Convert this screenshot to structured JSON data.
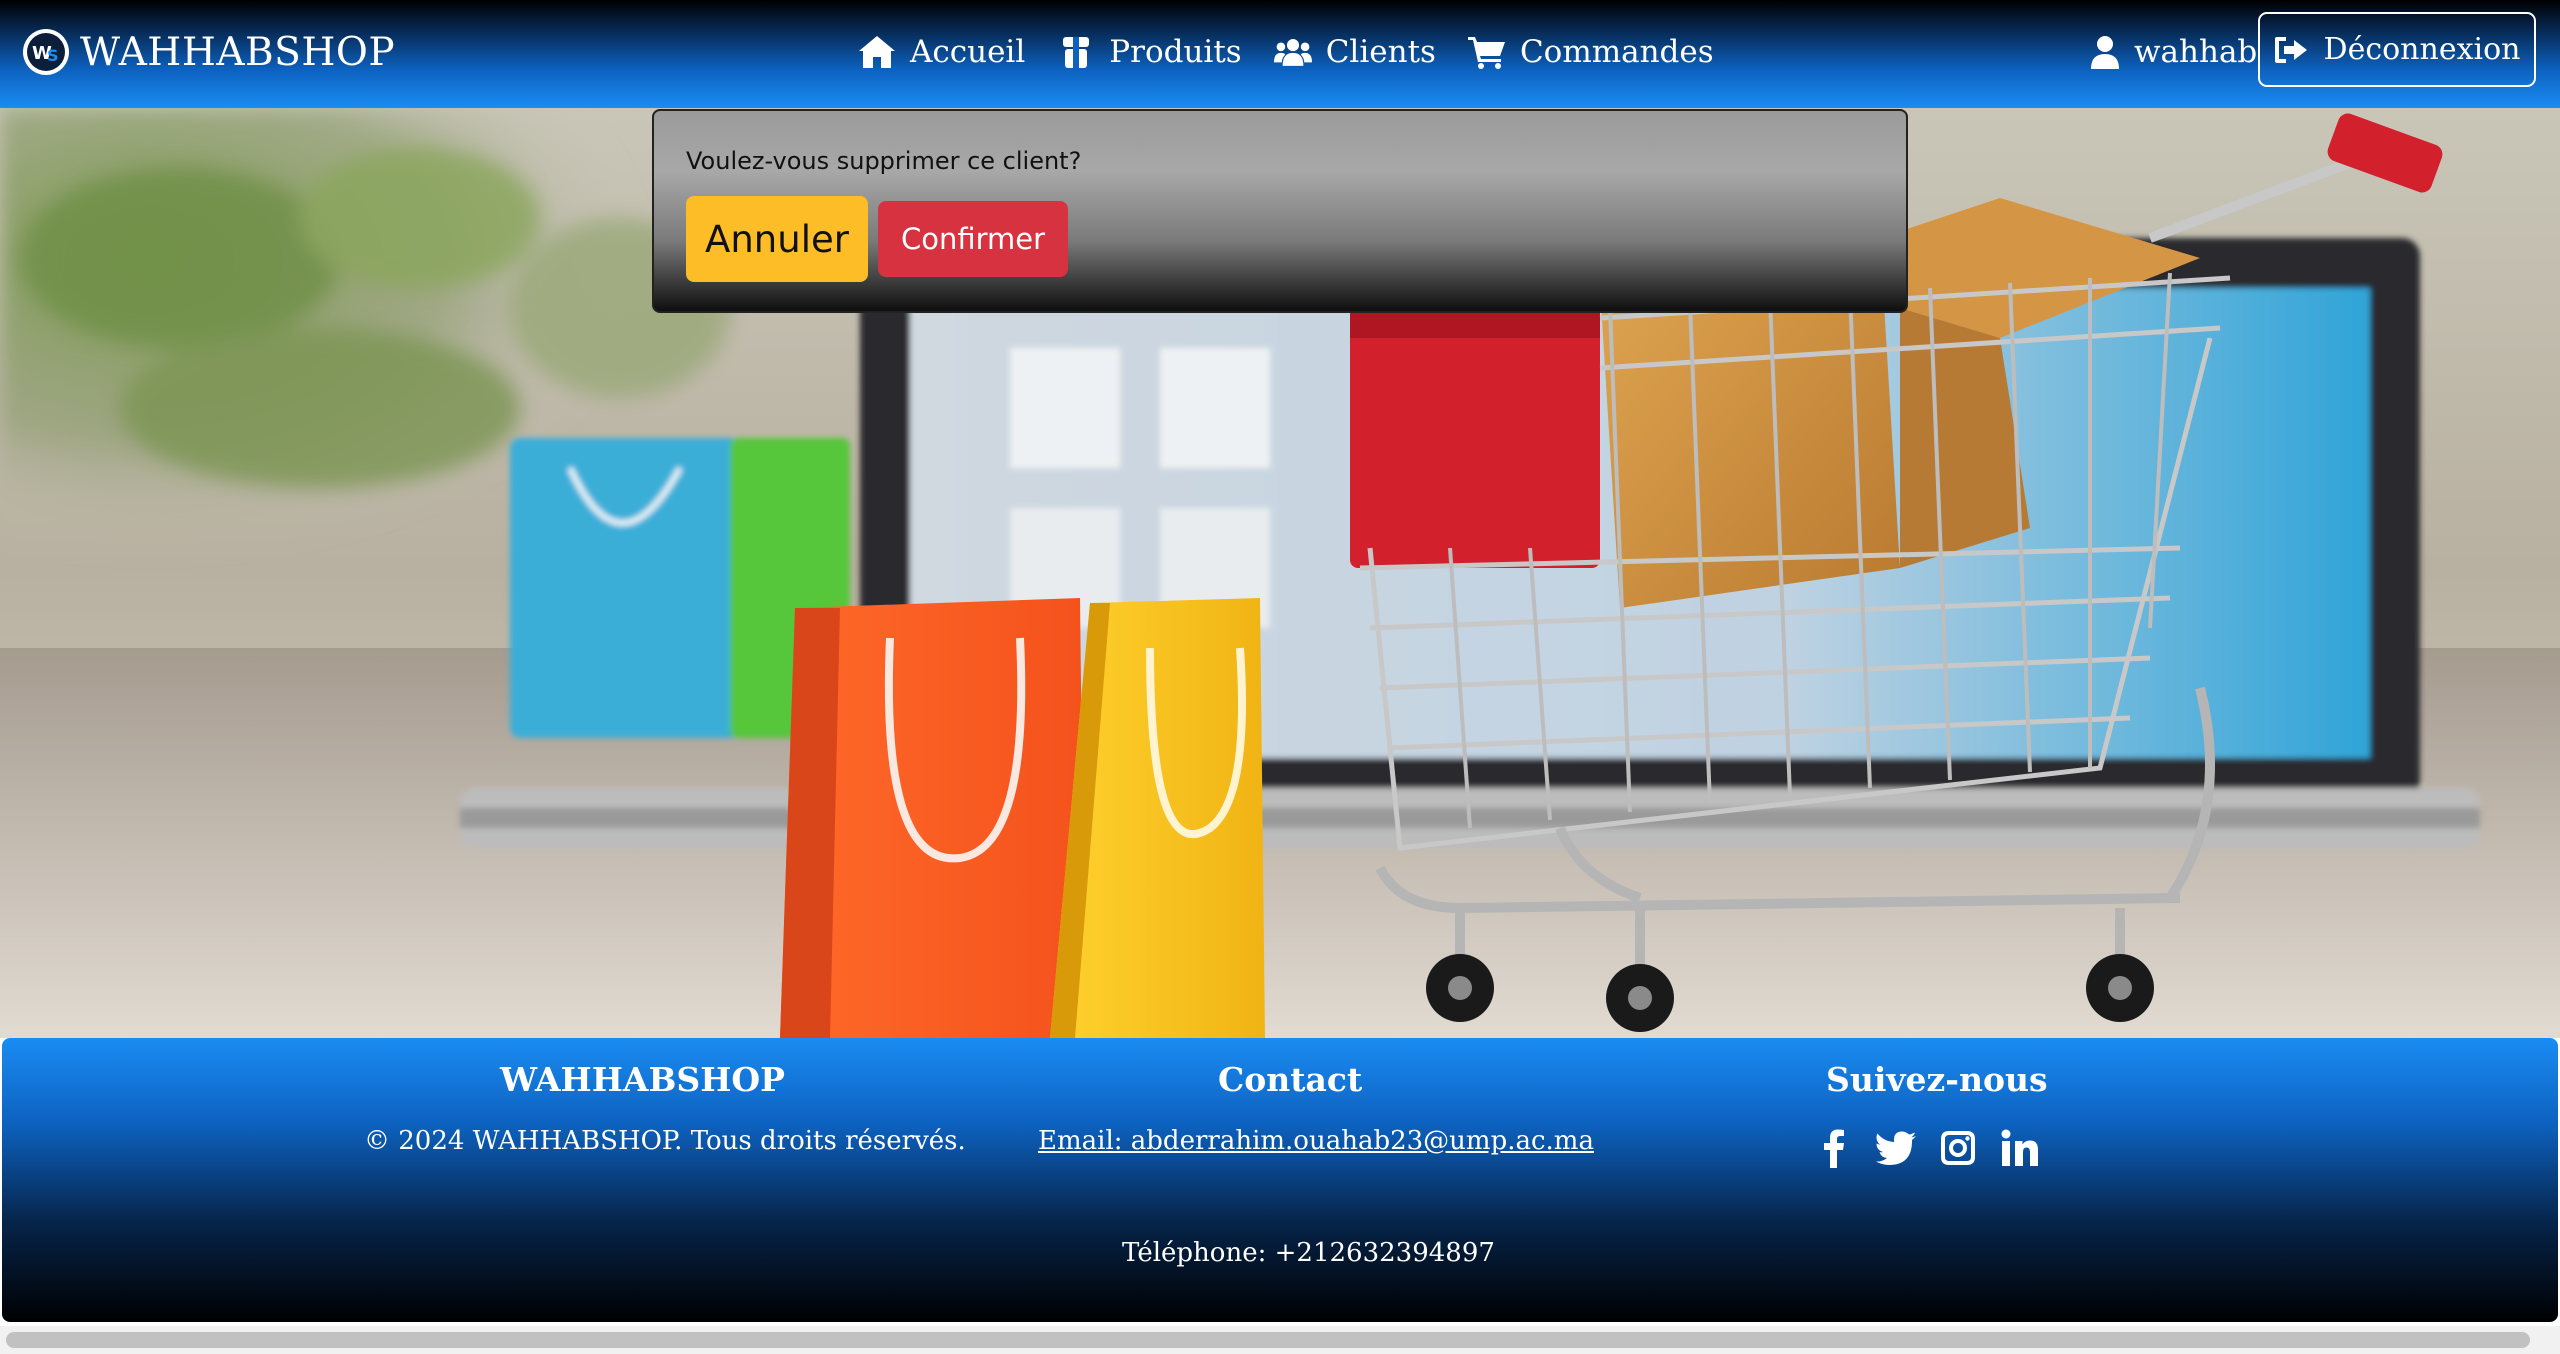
{
  "navbar": {
    "brand": "WAHHABSHOP",
    "links": {
      "home": "Accueil",
      "products": "Produits",
      "clients": "Clients",
      "orders": "Commandes"
    },
    "user": "wahhab",
    "logout": "Déconnexion",
    "icons": {
      "home": "home-icon",
      "products": "box-icon",
      "clients": "users-icon",
      "orders": "cart-icon",
      "user": "user-icon",
      "logout": "sign-out-icon"
    }
  },
  "dialog": {
    "message": "Voulez-vous supprimer ce client?",
    "cancel": "Annuler",
    "confirm": "Confirmer"
  },
  "hero": {
    "image": "shopping-cart-with-bags-and-laptop"
  },
  "footer": {
    "brand_title": "WAHHABSHOP",
    "copyright": "© 2024 WAHHABSHOP. Tous droits réservés.",
    "contact_title": "Contact",
    "email": "Email: abderrahim.ouahab23@ump.ac.ma",
    "phone": "Téléphone: +212632394897",
    "social_title": "Suivez-nous",
    "social_icons": [
      "facebook-icon",
      "twitter-icon",
      "instagram-icon",
      "linkedin-icon"
    ]
  },
  "colors": {
    "nav_light": "#1a8cf3",
    "annuler": "#fdbd27",
    "confirmer": "#d7323f"
  }
}
